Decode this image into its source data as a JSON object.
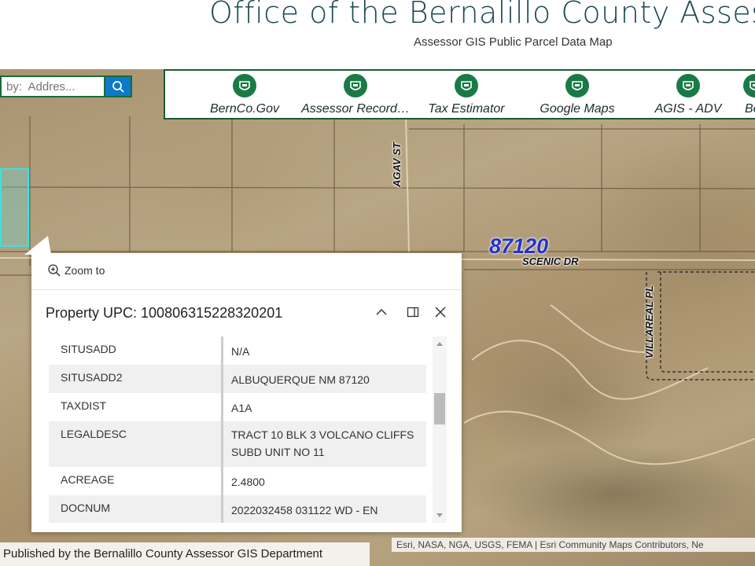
{
  "header": {
    "title": "Office of the Bernalillo County Assessor",
    "subtitle": "Assessor GIS Public Parcel Data Map"
  },
  "search": {
    "placeholder": "by:  Addres..."
  },
  "toolbar": {
    "items": [
      {
        "label": "BernCo.Gov",
        "icon": "bernco-logo-icon"
      },
      {
        "label": "Assessor Record…",
        "icon": "bernco-logo-icon"
      },
      {
        "label": "Tax Estimator",
        "icon": "bernco-logo-icon"
      },
      {
        "label": "Google Maps",
        "icon": "bernco-logo-icon"
      },
      {
        "label": "AGIS - ADV",
        "icon": "bernco-logo-icon"
      },
      {
        "label": "Be",
        "icon": "bernco-logo-icon"
      }
    ]
  },
  "map": {
    "streets": {
      "agav": "AGAV ST",
      "scenic": "SCENIC DR",
      "villareal": "VILLAREAL PL"
    },
    "zip": "87120"
  },
  "popup": {
    "zoom_to": "Zoom to",
    "title": "Property UPC:  100806315228320201",
    "rows": [
      {
        "key": "SITUSADD",
        "value": "N/A"
      },
      {
        "key": "SITUSADD2",
        "value": "ALBUQUERQUE NM 87120"
      },
      {
        "key": "TAXDIST",
        "value": "A1A"
      },
      {
        "key": "LEGALDESC",
        "value": "TRACT 10 BLK 3 VOLCANO CLIFFS SUBD UNIT NO 11"
      },
      {
        "key": "ACREAGE",
        "value": "2.4800"
      },
      {
        "key": "DOCNUM",
        "value": "2022032458 031122 WD - EN"
      }
    ]
  },
  "footer": {
    "published": "Published by the Bernalillo County Assessor GIS Department",
    "attribution": "Esri, NASA, NGA, USGS, FEMA | Esri Community Maps Contributors, Ne"
  },
  "colors": {
    "accent_green": "#1a7a45",
    "search_blue": "#0d79c9",
    "zip_blue": "#2431c9",
    "selection_cyan": "#3fe0e0"
  }
}
